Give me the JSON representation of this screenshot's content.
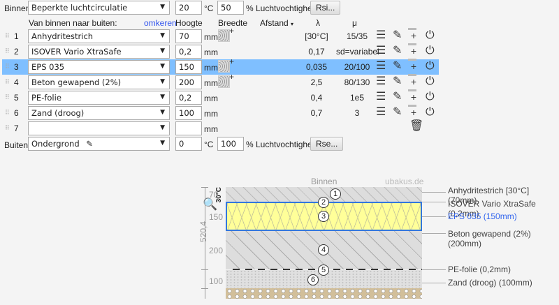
{
  "inside": {
    "label": "Binnen:",
    "climate": "Beperkte luchtcirculatie",
    "temp": "20",
    "temp_unit": "°C",
    "humidity": "50",
    "humidity_unit": "% Luchtvochtigheid",
    "rsi_button": "Rsi..."
  },
  "header": {
    "direction": "Van binnen naar buiten:",
    "reverse_link": "omkeren",
    "height": "Hoogte",
    "width": "Breedte",
    "distance": "Afstand",
    "lambda": "λ",
    "mu": "μ"
  },
  "layers": [
    {
      "n": "1",
      "material": "Anhydritestrich",
      "thickness": "70",
      "unit": "mm",
      "lambda": "[30°C]",
      "mu": "15/35",
      "width_icon": true
    },
    {
      "n": "2",
      "material": "ISOVER Vario XtraSafe",
      "thickness": "0,2",
      "unit": "mm",
      "lambda": "0,17",
      "mu": "sd=variabel",
      "width_icon": false
    },
    {
      "n": "3",
      "material": "EPS 035",
      "thickness": "150",
      "unit": "mm",
      "lambda": "0,035",
      "mu": "20/100",
      "width_icon": true,
      "selected": true
    },
    {
      "n": "4",
      "material": "Beton gewapend (2%)",
      "thickness": "200",
      "unit": "mm",
      "lambda": "2,5",
      "mu": "80/130",
      "width_icon": true
    },
    {
      "n": "5",
      "material": "PE-folie",
      "thickness": "0,2",
      "unit": "mm",
      "lambda": "0,4",
      "mu": "1e5",
      "width_icon": false
    },
    {
      "n": "6",
      "material": "Zand (droog)",
      "thickness": "100",
      "unit": "mm",
      "lambda": "0,7",
      "mu": "3",
      "width_icon": false
    },
    {
      "n": "7",
      "material": "",
      "thickness": "",
      "unit": "mm"
    }
  ],
  "outside": {
    "label": "Buiten:",
    "climate": "Ondergrond",
    "temp": "0",
    "temp_unit": "°C",
    "humidity": "100",
    "humidity_unit": "% Luchtvochtigheid",
    "rse_button": "Rse..."
  },
  "diagram": {
    "top_label": "Binnen",
    "watermark": "ubakus.de",
    "temp_marker": "30°C",
    "total": "520,4",
    "dims": [
      "70",
      "150",
      "200",
      "100"
    ],
    "labels": [
      "Anhydritestrich [30°C] (70mm)",
      "ISOVER Vario XtraSafe (0,2mm)",
      "EPS 035 (150mm)",
      "Beton gewapend (2%) (200mm)",
      "PE-folie (0,2mm)",
      "Zand (droog) (100mm)"
    ],
    "markers": [
      "1",
      "2",
      "3",
      "4",
      "5",
      "6"
    ]
  },
  "colors": {
    "selection": "#7fbfff",
    "insulation": "#ffff99",
    "link": "#3355ee",
    "selected_label": "#3366ee"
  }
}
